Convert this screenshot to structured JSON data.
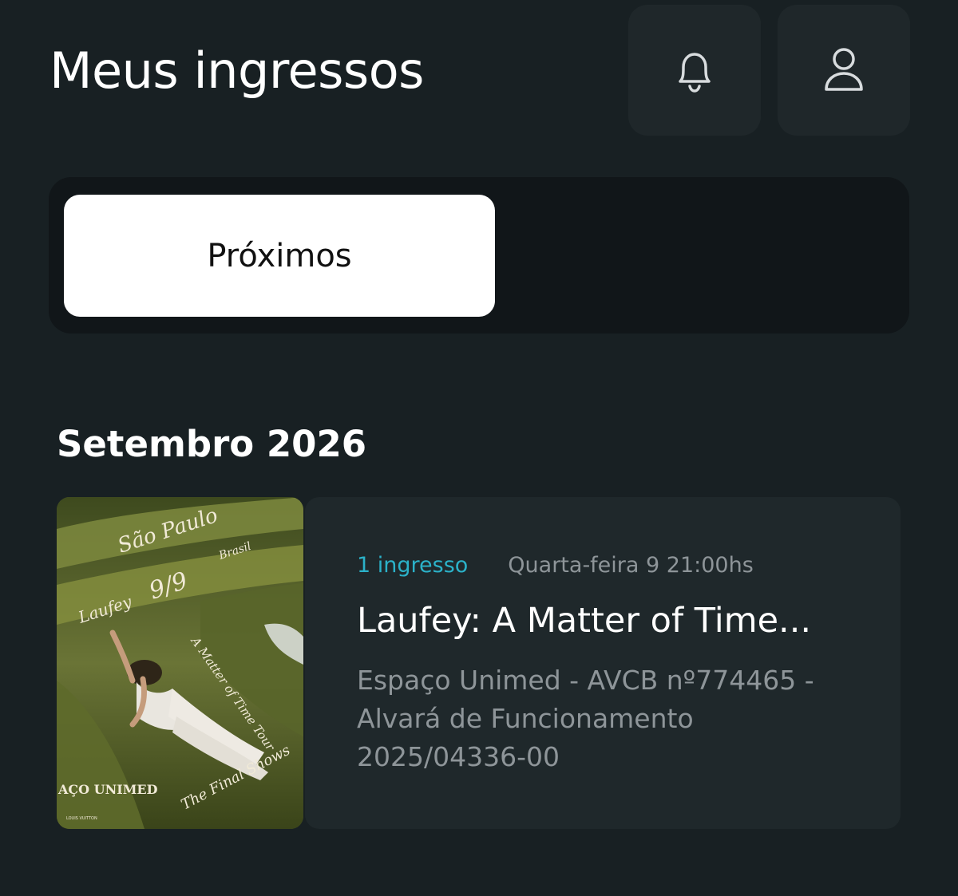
{
  "header": {
    "title": "Meus ingressos",
    "notifications_icon": "bell-icon",
    "profile_icon": "user-icon"
  },
  "tabs": {
    "active_label": "Próximos"
  },
  "section": {
    "month_heading": "Setembro 2026"
  },
  "ticket": {
    "count_label": "1 ingresso",
    "datetime": "Quarta-feira 9 21:00hs",
    "title": "Laufey: A Matter of Time...",
    "venue": "Espaço Unimed - AVCB nº774465 - Alvará de Funcionamento 2025/04336-00",
    "poster": {
      "city": "São Paulo",
      "country": "Brasil",
      "artist": "Laufey",
      "date": "9/9",
      "tour": "A Matter of Time Tour",
      "subtitle": "The Final Shows",
      "venue_text": "AÇO UNIMED",
      "sponsor": "LOUIS VUITTON"
    }
  },
  "colors": {
    "background": "#182023",
    "accent": "#2bb2c9",
    "muted_text": "#8e9599",
    "card": "#1f282b"
  }
}
